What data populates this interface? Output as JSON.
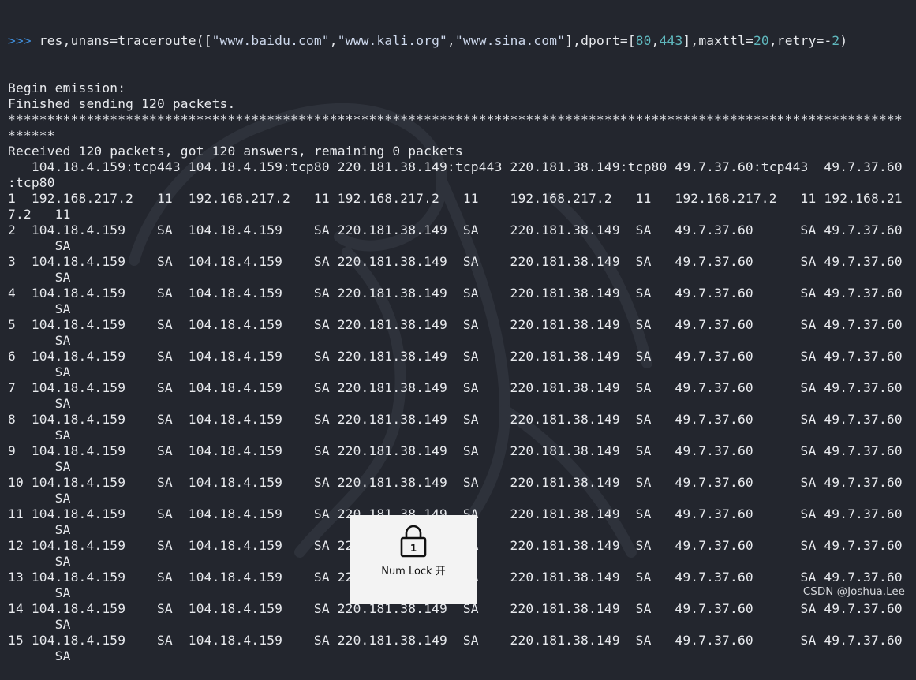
{
  "terminal": {
    "prompt": ">>>",
    "command_parts": [
      {
        "t": " res,unans=traceroute([",
        "c": "plain"
      },
      {
        "t": "\"www.baidu.com\"",
        "c": "str"
      },
      {
        "t": ",",
        "c": "plain"
      },
      {
        "t": "\"www.kali.org\"",
        "c": "str"
      },
      {
        "t": ",",
        "c": "plain"
      },
      {
        "t": "\"www.sina.com\"",
        "c": "str"
      },
      {
        "t": "],dport=[",
        "c": "plain"
      },
      {
        "t": "80",
        "c": "num"
      },
      {
        "t": ",",
        "c": "plain"
      },
      {
        "t": "443",
        "c": "num"
      },
      {
        "t": "],maxttl=",
        "c": "plain"
      },
      {
        "t": "20",
        "c": "num"
      },
      {
        "t": ",retry=-",
        "c": "plain"
      },
      {
        "t": "2",
        "c": "num"
      },
      {
        "t": ")",
        "c": "plain"
      }
    ],
    "output_lines": [
      "Begin emission:",
      "Finished sending 120 packets.",
      "******************************************************************************************************************",
      "******",
      "Received 120 packets, got 120 answers, remaining 0 packets",
      "   104.18.4.159:tcp443 104.18.4.159:tcp80 220.181.38.149:tcp443 220.181.38.149:tcp80 49.7.37.60:tcp443  49.7.37.60",
      ":tcp80",
      "1  192.168.217.2   11  192.168.217.2   11 192.168.217.2   11    192.168.217.2   11   192.168.217.2   11 192.168.21",
      "7.2   11",
      "2  104.18.4.159    SA  104.18.4.159    SA 220.181.38.149  SA    220.181.38.149  SA   49.7.37.60      SA 49.7.37.60",
      "      SA",
      "3  104.18.4.159    SA  104.18.4.159    SA 220.181.38.149  SA    220.181.38.149  SA   49.7.37.60      SA 49.7.37.60",
      "      SA",
      "4  104.18.4.159    SA  104.18.4.159    SA 220.181.38.149  SA    220.181.38.149  SA   49.7.37.60      SA 49.7.37.60",
      "      SA",
      "5  104.18.4.159    SA  104.18.4.159    SA 220.181.38.149  SA    220.181.38.149  SA   49.7.37.60      SA 49.7.37.60",
      "      SA",
      "6  104.18.4.159    SA  104.18.4.159    SA 220.181.38.149  SA    220.181.38.149  SA   49.7.37.60      SA 49.7.37.60",
      "      SA",
      "7  104.18.4.159    SA  104.18.4.159    SA 220.181.38.149  SA    220.181.38.149  SA   49.7.37.60      SA 49.7.37.60",
      "      SA",
      "8  104.18.4.159    SA  104.18.4.159    SA 220.181.38.149  SA    220.181.38.149  SA   49.7.37.60      SA 49.7.37.60",
      "      SA",
      "9  104.18.4.159    SA  104.18.4.159    SA 220.181.38.149  SA    220.181.38.149  SA   49.7.37.60      SA 49.7.37.60",
      "      SA",
      "10 104.18.4.159    SA  104.18.4.159    SA 220.181.38.149  SA    220.181.38.149  SA   49.7.37.60      SA 49.7.37.60",
      "      SA",
      "11 104.18.4.159    SA  104.18.4.159    SA 220.181.38.149  SA    220.181.38.149  SA   49.7.37.60      SA 49.7.37.60",
      "      SA",
      "12 104.18.4.159    SA  104.18.4.159    SA 220.181.38.149  SA    220.181.38.149  SA   49.7.37.60      SA 49.7.37.60",
      "      SA",
      "13 104.18.4.159    SA  104.18.4.159    SA 220.181.38.149  SA    220.181.38.149  SA   49.7.37.60      SA 49.7.37.60",
      "      SA",
      "14 104.18.4.159    SA  104.18.4.159    SA 220.181.38.149  SA    220.181.38.149  SA   49.7.37.60      SA 49.7.37.60",
      "      SA",
      "15 104.18.4.159    SA  104.18.4.159    SA 220.181.38.149  SA    220.181.38.149  SA   49.7.37.60      SA 49.7.37.60",
      "      SA"
    ]
  },
  "osd": {
    "icon": "lock-icon",
    "icon_digit": "1",
    "label": "Num Lock 开"
  },
  "watermark": "CSDN @Joshua.Lee",
  "colors": {
    "background": "#23262e",
    "text": "#e8eaee",
    "prompt": "#3f8bd6",
    "string": "#cdd8ec",
    "number": "#5fb7bd",
    "osd_background": "#f3f3f3"
  }
}
